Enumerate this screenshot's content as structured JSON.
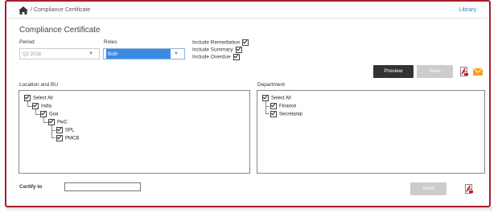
{
  "breadcrumb": {
    "separator": "/",
    "current": "Compliance Certificate",
    "home_icon": "home-icon"
  },
  "header": {
    "library_link": "Library"
  },
  "page": {
    "title": "Compliance Certificate"
  },
  "filters": {
    "period": {
      "label": "Period",
      "value": "Q2 2018"
    },
    "roles": {
      "label": "Roles",
      "value": "Both"
    },
    "include_remediation": {
      "label": "Include Remediation",
      "checked": true
    },
    "include_summary": {
      "label": "Include Summary",
      "checked": true
    },
    "include_overdue": {
      "label": "Include Overdue",
      "checked": true
    }
  },
  "actions": {
    "preview": "Preview",
    "save": "Save"
  },
  "location": {
    "label": "Location and BU",
    "items": [
      {
        "label": "Select All",
        "checked": true
      },
      {
        "label": "India",
        "checked": true
      },
      {
        "label": "Goa",
        "checked": true
      },
      {
        "label": "PwC",
        "checked": true
      },
      {
        "label": "SPL",
        "checked": true
      },
      {
        "label": "PMCB",
        "checked": true
      }
    ]
  },
  "department": {
    "label": "Department",
    "items": [
      {
        "label": "Select All",
        "checked": true
      },
      {
        "label": "Finance",
        "checked": true
      },
      {
        "label": "Secretarial",
        "checked": true
      }
    ]
  },
  "certify": {
    "label": "Certify to",
    "value": "",
    "save": "Save"
  },
  "colors": {
    "border": "#a3202a",
    "link": "#3e7bc4",
    "selected": "#3b8ae2",
    "dark_button": "#333333",
    "disabled_button": "#cccccc",
    "mail": "#f0a21b",
    "pdf": "#c8202a"
  }
}
